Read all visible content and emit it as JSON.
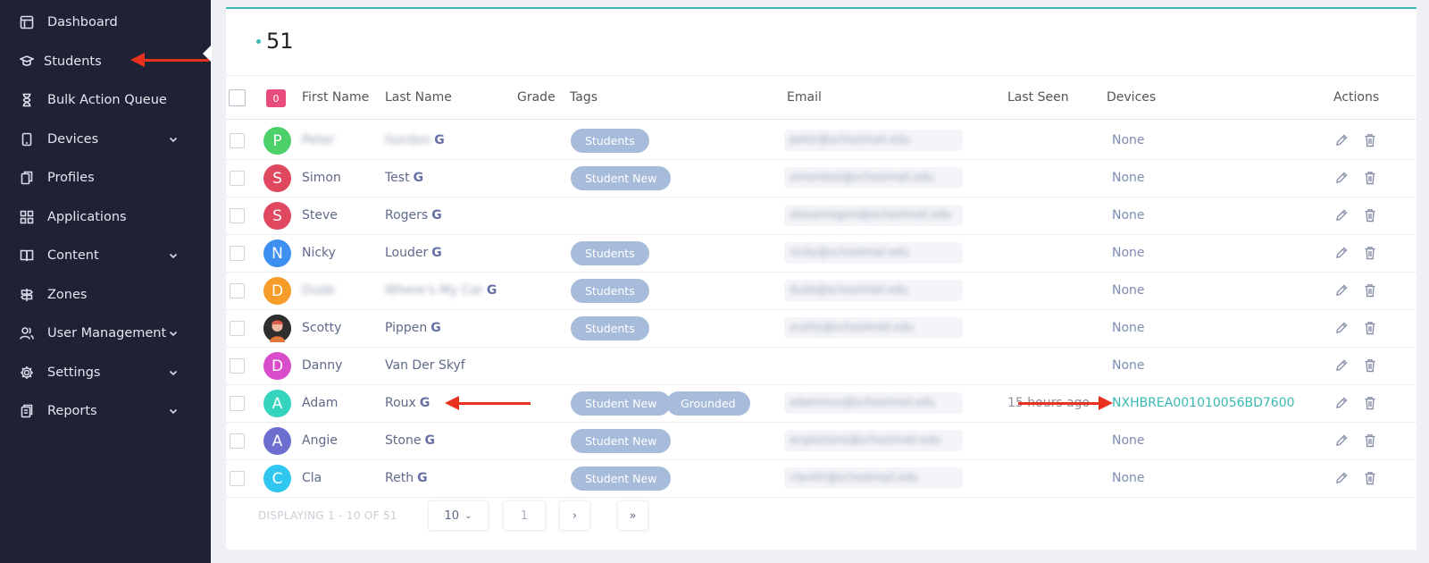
{
  "sidebar": {
    "items": [
      {
        "label": "Dashboard",
        "icon": "dashboard-icon",
        "has_chevron": false
      },
      {
        "label": "Students",
        "icon": "graduation-cap-icon",
        "has_chevron": false
      },
      {
        "label": "Bulk Action Queue",
        "icon": "hourglass-icon",
        "has_chevron": false
      },
      {
        "label": "Devices",
        "icon": "tablet-icon",
        "has_chevron": true
      },
      {
        "label": "Profiles",
        "icon": "profiles-icon",
        "has_chevron": false
      },
      {
        "label": "Applications",
        "icon": "grid-icon",
        "has_chevron": false
      },
      {
        "label": "Content",
        "icon": "book-icon",
        "has_chevron": true
      },
      {
        "label": "Zones",
        "icon": "signpost-icon",
        "has_chevron": false
      },
      {
        "label": "User Management",
        "icon": "users-icon",
        "has_chevron": true
      },
      {
        "label": "Settings",
        "icon": "gear-icon",
        "has_chevron": true
      },
      {
        "label": "Reports",
        "icon": "reports-icon",
        "has_chevron": true
      }
    ]
  },
  "main": {
    "count": "51",
    "selected_count": "0",
    "columns": [
      "First Name",
      "Last Name",
      "Grade",
      "Tags",
      "Email",
      "Last Seen",
      "Devices",
      "Actions"
    ],
    "rows": [
      {
        "initial": "P",
        "avatar_color": "#4cd06a",
        "first": "Peter",
        "last": "Gordon",
        "blurred": true,
        "tags": [
          "Students"
        ],
        "email": "peter@schoolmail.edu",
        "last_seen": "",
        "devices": "None"
      },
      {
        "initial": "S",
        "avatar_color": "#e0485f",
        "first": "Simon",
        "last": "Test",
        "blurred": false,
        "tags": [
          "Student New"
        ],
        "email": "simontest@schoolmail.edu",
        "last_seen": "",
        "devices": "None"
      },
      {
        "initial": "S",
        "avatar_color": "#e0485f",
        "first": "Steve",
        "last": "Rogers",
        "blurred": false,
        "tags": [],
        "email": "stevenrogers@schoolmail.edu",
        "last_seen": "",
        "devices": "None"
      },
      {
        "initial": "N",
        "avatar_color": "#3d8ff0",
        "first": "Nicky",
        "last": "Louder",
        "blurred": false,
        "tags": [
          "Students"
        ],
        "email": "nicky@schoolmail.edu",
        "last_seen": "",
        "devices": "None"
      },
      {
        "initial": "D",
        "avatar_color": "#f59c2a",
        "first": "Dude",
        "last": "Where's My Car",
        "blurred": true,
        "tags": [
          "Students"
        ],
        "email": "dude@schoolmail.edu",
        "last_seen": "",
        "devices": "None"
      },
      {
        "initial": "",
        "avatar_color": "#3a3a3a",
        "first": "Scotty",
        "last": "Pippen",
        "blurred": false,
        "tags": [
          "Students"
        ],
        "email": "scotty@schoolmail.edu",
        "last_seen": "",
        "devices": "None"
      },
      {
        "initial": "D",
        "avatar_color": "#d94dcb",
        "first": "Danny",
        "last": "Van Der Skyf",
        "blurred": false,
        "tags": [],
        "email": "",
        "last_seen": "",
        "devices": "None"
      },
      {
        "initial": "A",
        "avatar_color": "#34d4bf",
        "first": "Adam",
        "last": "Roux",
        "blurred": false,
        "tags": [
          "Student New",
          "Grounded"
        ],
        "email": "adamroux@schoolmail.edu",
        "last_seen": "15 hours ago",
        "devices": "NXHBREA001010056BD7600"
      },
      {
        "initial": "A",
        "avatar_color": "#6c6fd0",
        "first": "Angie",
        "last": "Stone",
        "blurred": false,
        "tags": [
          "Student New"
        ],
        "email": "angiestone@schoolmail.edu",
        "last_seen": "",
        "devices": "None"
      },
      {
        "initial": "C",
        "avatar_color": "#2fc6ef",
        "first": "Cla",
        "last": "Reth",
        "blurred": false,
        "tags": [
          "Student New"
        ],
        "email": "clareth@schoolmail.edu",
        "last_seen": "",
        "devices": "None"
      }
    ],
    "pagination": {
      "display_text": "DISPLAYING 1 - 10 OF 51",
      "page_size": "10",
      "page": "1",
      "next_symbol": "›",
      "last_symbol": "»"
    }
  },
  "colors": {
    "accent": "#39b9b3",
    "sidebar_bg": "#1f2235",
    "tag_bg": "#a7bcda",
    "arrow": "#e8321f"
  }
}
